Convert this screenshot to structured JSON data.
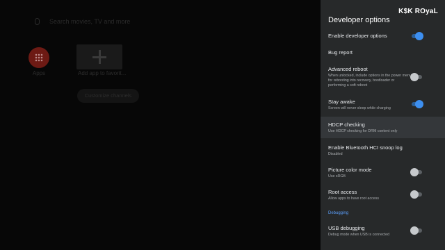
{
  "home": {
    "search_placeholder": "Search movies, TV and more",
    "apps_label": "Apps",
    "add_app_label": "Add app to favorit...",
    "customize_button": "Customize channels"
  },
  "watermark": "K$K ROyaL",
  "panel": {
    "title": "Developer options",
    "rows": [
      {
        "title": "Enable developer options",
        "toggle": true
      },
      {
        "title": "Bug report"
      },
      {
        "title": "Advanced reboot",
        "subtitle": "When unlocked, include options in the power menu for rebooting into recovery, bootloader or performing a soft reboot",
        "toggle": false
      },
      {
        "title": "Stay awake",
        "subtitle": "Screen will never sleep while charging",
        "toggle": true
      },
      {
        "title": "HDCP checking",
        "subtitle": "Use HDCP checking for DRM content only",
        "focused": true
      },
      {
        "title": "Enable Bluetooth HCI snoop log",
        "subtitle": "Disabled"
      },
      {
        "title": "Picture color mode",
        "subtitle": "Use sRGB",
        "toggle": false
      },
      {
        "title": "Root access",
        "subtitle": "Allow apps to have root access",
        "toggle": false
      },
      {
        "title": "USB debugging",
        "subtitle": "Debug mode when USB is connected",
        "toggle": false
      }
    ],
    "section_debugging": "Debugging"
  },
  "colors": {
    "accent": "#3d8ff0",
    "panel_bg": "#27292a",
    "section": "#5a9df8"
  }
}
